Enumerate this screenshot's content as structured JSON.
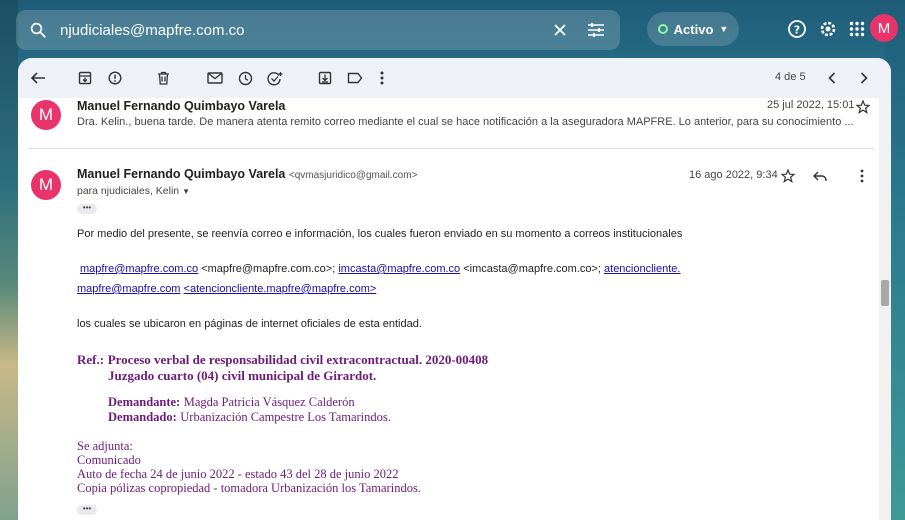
{
  "search": {
    "value": "njudiciales@mapfre.com.co"
  },
  "status": {
    "label": "Activo"
  },
  "account": {
    "initial": "M"
  },
  "toolbar": {
    "pager": "4 de 5"
  },
  "message1": {
    "initial": "M",
    "sender": "Manuel Fernando Quimbayo Varela",
    "date": "25 jul 2022, 15:01",
    "snippet": "Dra. Kelin., buena tarde. De manera atenta remito correo mediante el cual se hace notificación a la aseguradora MAPFRE. Lo anterior, para su conocimiento ..."
  },
  "message2": {
    "initial": "M",
    "sender": "Manuel Fernando Quimbayo Varela",
    "email": "<qvmasjuridico@gmail.com>",
    "date": "16 ago 2022, 9:34",
    "to": "para njudiciales, Kelin",
    "dots": "•••",
    "intro": "Por medio del presente, se reenvía correo e información, los cuales fueron enviado en su momento a correos institucionales",
    "link1": "mapfre@mapfre.com.co",
    "link1b": "<mapfre@mapfre.com.co>",
    "link2": "imcasta@mapfre.com.co",
    "link2b": "<imcasta@mapfre.com.co>",
    "link3a": "atencioncliente.",
    "link3b": "mapfre@mapfre.com",
    "link3c": "<atencioncliente.mapfre@mapfre.com>",
    "sep": "; ",
    "closing": "los cuales se ubicaron en páginas de internet oficiales de esta entidad.",
    "ref_label": "Ref.:",
    "ref_line1": "Proceso verbal de responsabilidad civil extracontractual. 2020-00408",
    "ref_line2": "Juzgado cuarto (04) civil municipal de Girardot.",
    "demandante_label": "Demandante:",
    "demandante": "Magda Patricia Vásquez Calderón",
    "demandado_label": "Demandado:",
    "demandado": "Urbanización Campestre Los Tamarindos.",
    "attach_title": "Se adjunta:",
    "attach": [
      "Comunicado",
      "Auto de fecha 24 de junio 2022 - estado 43 del 28 de junio 2022",
      "Copia pólizas copropiedad - tomadora Urbanización los Tamarindos."
    ],
    "dots2": "•••"
  }
}
